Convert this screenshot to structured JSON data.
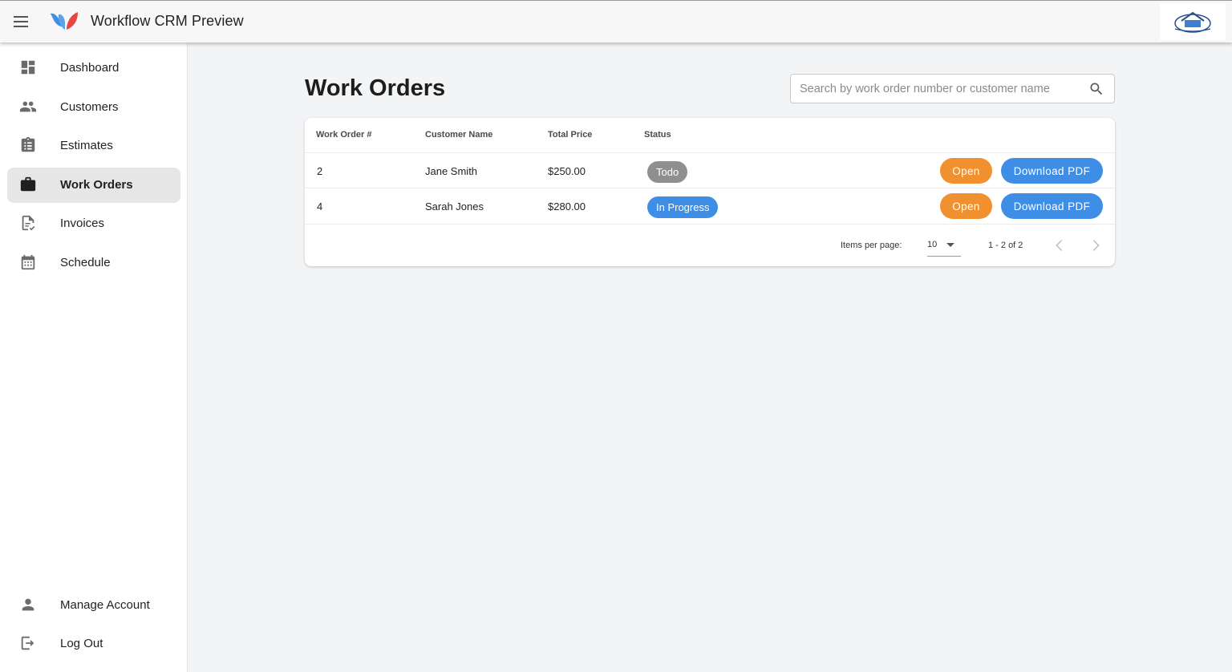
{
  "app": {
    "title": "Workflow CRM Preview",
    "menu_icon": "hamburger-menu-icon",
    "logo_icon": "workflow-logo-icon",
    "company_logo": "calabash-logo"
  },
  "sidebar": {
    "items": [
      {
        "label": "Dashboard",
        "icon": "dashboard-icon",
        "active": false
      },
      {
        "label": "Customers",
        "icon": "people-icon",
        "active": false
      },
      {
        "label": "Estimates",
        "icon": "clipboard-list-icon",
        "active": false
      },
      {
        "label": "Work Orders",
        "icon": "briefcase-icon",
        "active": true
      },
      {
        "label": "Invoices",
        "icon": "document-check-icon",
        "active": false
      },
      {
        "label": "Schedule",
        "icon": "calendar-icon",
        "active": false
      }
    ],
    "bottom_items": [
      {
        "label": "Manage Account",
        "icon": "person-icon"
      },
      {
        "label": "Log Out",
        "icon": "logout-icon"
      }
    ]
  },
  "main": {
    "title": "Work Orders",
    "search": {
      "placeholder": "Search by work order number or customer name",
      "value": ""
    },
    "table": {
      "columns": [
        "Work Order #",
        "Customer Name",
        "Total Price",
        "Status"
      ],
      "rows": [
        {
          "number": "2",
          "customer": "Jane Smith",
          "price": "$250.00",
          "status": "Todo",
          "status_color": "#8f8f8f"
        },
        {
          "number": "4",
          "customer": "Sarah Jones",
          "price": "$280.00",
          "status": "In Progress",
          "status_color": "#3f8ee6"
        }
      ],
      "actions": {
        "open_label": "Open",
        "pdf_label": "Download PDF"
      }
    },
    "paginator": {
      "items_per_page_label": "Items per page:",
      "items_per_page": "10",
      "range": "1 - 2 of 2"
    }
  },
  "colors": {
    "accent_orange": "#f0902f",
    "accent_blue": "#3f8ee6",
    "active_nav_bg": "#e6e6e6"
  }
}
